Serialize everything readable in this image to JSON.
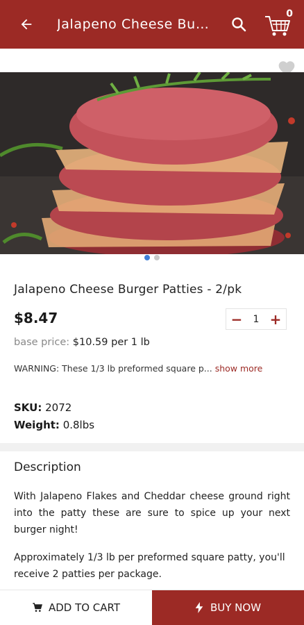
{
  "header": {
    "title": "Jalapeno Cheese Burger Patties - 2/pk",
    "cart_count": "0"
  },
  "product": {
    "name": "Jalapeno Cheese Burger Patties - 2/pk",
    "price": "$8.47",
    "quantity": "1",
    "base_price_label": "base price:",
    "base_price_value": "$10.59 per 1 lb",
    "warning_text": "WARNING: These 1/3 lb preformed square p...",
    "show_more": "show more",
    "sku_label": "SKU:",
    "sku_value": "2072",
    "weight_label": "Weight:",
    "weight_value": "0.8lbs",
    "image_count": 2,
    "active_image": 1
  },
  "description": {
    "heading": "Description",
    "p1": "With Jalapeno Flakes and Cheddar cheese ground right into the patty these are sure to spice up your next burger night!",
    "p2": "Approximately 1/3 lb per preformed square patty, you'll receive 2 patties per package."
  },
  "actions": {
    "add_to_cart": "ADD TO CART",
    "buy_now": "BUY NOW"
  },
  "colors": {
    "brand": "#9c2a25",
    "carousel_active": "#3f7fd8"
  }
}
